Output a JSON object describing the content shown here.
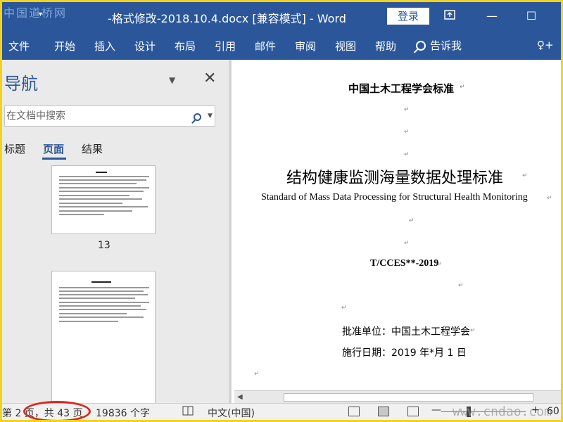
{
  "watermark": {
    "top": "中国道桥网",
    "bottom": "www.cndao.com"
  },
  "titlebar": {
    "qat_caret": "▾",
    "title": "-格式修改-2018.10.4.docx [兼容模式]  -  Word",
    "login_label": "登录",
    "restore_ribbon_icon": "ribbon-display-icon",
    "minimize_glyph": "—",
    "maximize_glyph": "☐"
  },
  "ribbon": {
    "tabs": [
      "文件",
      "开始",
      "插入",
      "设计",
      "布局",
      "引用",
      "邮件",
      "审阅",
      "视图",
      "帮助"
    ],
    "tell_me": "告诉我",
    "share_glyph": "♀+"
  },
  "nav": {
    "title": "导航",
    "dropdown_glyph": "▼",
    "close_glyph": "✕",
    "search_placeholder": "在文档中搜索",
    "search_caret": "▼",
    "tabs": [
      "标题",
      "页面",
      "结果"
    ],
    "active_tab": "页面",
    "pages": [
      "13"
    ]
  },
  "document": {
    "header": "中国土木工程学会标准",
    "title_cn": "结构健康监测海量数据处理标准",
    "title_en": "Standard of Mass Data Processing for Structural Health Monitoring",
    "code": "T/CCES**-2019",
    "approver": "批准单位：中国土木工程学会",
    "date": "施行日期：2019 年*月 1 日",
    "paragraph_mark": "↵"
  },
  "statusbar": {
    "page_prefix": "第 2 页",
    "page_total": "，共 43 页",
    "word_count": "19836 个字",
    "language": "中文(中国)",
    "zoom_minus": "—",
    "zoom_plus": "+",
    "zoom_value": "60"
  },
  "colors": {
    "word_blue": "#2b579a",
    "frame_yellow": "#f6d21a",
    "highlight_red": "#d9281f"
  }
}
